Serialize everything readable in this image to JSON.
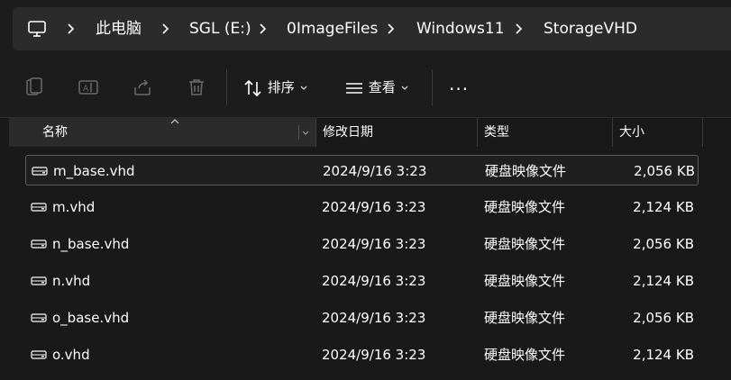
{
  "breadcrumb": {
    "items": [
      "此电脑",
      "SGL (E:)",
      "0ImageFiles",
      "Windows11",
      "StorageVHD"
    ]
  },
  "toolbar": {
    "sort_label": "排序",
    "view_label": "查看",
    "more_label": "..."
  },
  "columns": {
    "name": "名称",
    "modified": "修改日期",
    "type": "类型",
    "size": "大小"
  },
  "files": [
    {
      "name": "m_base.vhd",
      "modified": "2024/9/16 3:23",
      "type": "硬盘映像文件",
      "size": "2,056 KB"
    },
    {
      "name": "m.vhd",
      "modified": "2024/9/16 3:23",
      "type": "硬盘映像文件",
      "size": "2,124 KB"
    },
    {
      "name": "n_base.vhd",
      "modified": "2024/9/16 3:23",
      "type": "硬盘映像文件",
      "size": "2,056 KB"
    },
    {
      "name": "n.vhd",
      "modified": "2024/9/16 3:23",
      "type": "硬盘映像文件",
      "size": "2,124 KB"
    },
    {
      "name": "o_base.vhd",
      "modified": "2024/9/16 3:23",
      "type": "硬盘映像文件",
      "size": "2,056 KB"
    },
    {
      "name": "o.vhd",
      "modified": "2024/9/16 3:23",
      "type": "硬盘映像文件",
      "size": "2,124 KB"
    }
  ],
  "icons": {
    "computer": "computer-icon",
    "copy": "copy-icon",
    "rename": "rename-icon",
    "share": "share-icon",
    "delete": "trash-icon",
    "sort": "sort-icon",
    "view": "view-icon",
    "drive": "drive-icon"
  },
  "colors": {
    "background": "#191919",
    "bar": "#2b2b2b",
    "text": "#ffffff",
    "muted": "#8a8a8a"
  }
}
